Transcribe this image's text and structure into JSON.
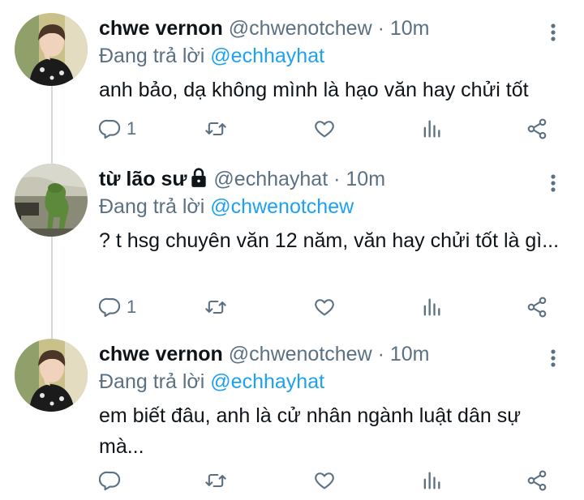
{
  "tweets": [
    {
      "name": "chwe vernon",
      "handle": "@chwenotchew",
      "time": "10m",
      "reply_prefix": "Đang trả lời",
      "reply_to": "@echhayhat",
      "text": "anh bảo, dạ không mình là hạo văn hay chửi tốt",
      "reply_count": "1",
      "avatar": "avatar-vernon",
      "locked": false
    },
    {
      "name": "từ lão sư",
      "handle": "@echhayhat",
      "time": "10m",
      "reply_prefix": "Đang trả lời",
      "reply_to": "@chwenotchew",
      "text": "? t hsg chuyên văn 12 năm, văn hay chửi tốt là gì...",
      "reply_count": "1",
      "avatar": "avatar-kermit",
      "locked": true
    },
    {
      "name": "chwe vernon",
      "handle": "@chwenotchew",
      "time": "10m",
      "reply_prefix": "Đang trả lời",
      "reply_to": "@echhayhat",
      "text": "em biết đâu, anh là cử nhân ngành luật dân sự mà...",
      "reply_count": "",
      "avatar": "avatar-vernon",
      "locked": false
    }
  ],
  "separator": "·",
  "colors": {
    "link": "#1da1f2",
    "secondary": "#5b7083",
    "text": "#0f1419",
    "thread_line": "#cfd9de"
  },
  "icons": [
    "reply-icon",
    "retweet-icon",
    "like-icon",
    "analytics-icon",
    "share-icon",
    "more-icon",
    "lock-icon"
  ]
}
